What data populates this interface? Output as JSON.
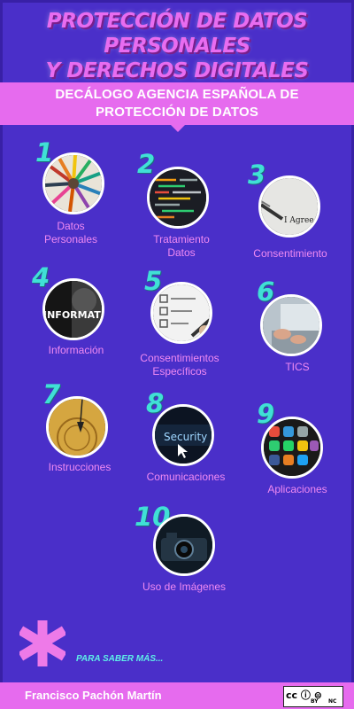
{
  "header": {
    "title_line1": "PROTECCIÓN DE DATOS PERSONALES",
    "title_line2": "Y DERECHOS DIGITALES",
    "banner_line1": "DECÁLOGO AGENCIA ESPAÑOLA DE",
    "banner_line2": "PROTECCIÓN DE DATOS"
  },
  "items": [
    {
      "number": "1",
      "label_line1": "Datos",
      "label_line2": "Personales",
      "icon": "colored-pencils-icon"
    },
    {
      "number": "2",
      "label_line1": "Tratamiento",
      "label_line2": "Datos",
      "icon": "code-screen-icon"
    },
    {
      "number": "3",
      "label_line1": "Consentimiento",
      "label_line2": "",
      "icon": "i-agree-pen-icon",
      "image_text": "I Agree"
    },
    {
      "number": "4",
      "label_line1": "Información",
      "label_line2": "",
      "icon": "information-word-icon",
      "image_text": "INFORMATIO"
    },
    {
      "number": "5",
      "label_line1": "Consentimientos",
      "label_line2": "Específicos",
      "icon": "checklist-icon"
    },
    {
      "number": "6",
      "label_line1": "TICS",
      "label_line2": "",
      "icon": "laptop-hands-icon"
    },
    {
      "number": "7",
      "label_line1": "Instrucciones",
      "label_line2": "",
      "icon": "pendulum-icon"
    },
    {
      "number": "8",
      "label_line1": "Comunicaciones",
      "label_line2": "",
      "icon": "security-screen-icon",
      "image_text": "Security"
    },
    {
      "number": "9",
      "label_line1": "Aplicaciones",
      "label_line2": "",
      "icon": "phone-apps-icon"
    },
    {
      "number": "10",
      "label_line1": "Uso de Imágenes",
      "label_line2": "",
      "icon": "camera-icon"
    }
  ],
  "more": {
    "label": "PARA SABER MÁS..."
  },
  "footer": {
    "author": "Francisco Pachón Martín",
    "license_main": "cc ⓘ ⊜",
    "license_by": "BY",
    "license_nc": "NC"
  },
  "colors": {
    "background": "#4a2fc9",
    "accent": "#e66bee",
    "number": "#40e0d6",
    "label": "#f08af2"
  }
}
